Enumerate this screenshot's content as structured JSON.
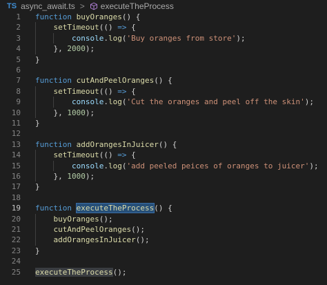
{
  "breadcrumb": {
    "language_badge": "TS",
    "file_name": "async_await.ts",
    "separator": ">",
    "symbol_icon": "cube-icon",
    "symbol_name": "executeTheProcess"
  },
  "colors": {
    "background": "#1e1e1e",
    "keyword": "#569cd6",
    "function": "#dcdcaa",
    "string": "#ce9178",
    "number": "#b5cea8",
    "property": "#9cdcfe",
    "selection": "#264f78"
  },
  "editor": {
    "active_line": 19,
    "lines": [
      {
        "n": "1",
        "tokens": [
          {
            "t": "function ",
            "c": "kw"
          },
          {
            "t": "buyOranges",
            "c": "fn"
          },
          {
            "t": "() {"
          }
        ]
      },
      {
        "n": "2",
        "tokens": [
          {
            "t": "    "
          },
          {
            "t": "setTimeout",
            "c": "fn"
          },
          {
            "t": "(() "
          },
          {
            "t": "=>",
            "c": "kw"
          },
          {
            "t": " {"
          }
        ]
      },
      {
        "n": "3",
        "tokens": [
          {
            "t": "        "
          },
          {
            "t": "console",
            "c": "var"
          },
          {
            "t": "."
          },
          {
            "t": "log",
            "c": "fn"
          },
          {
            "t": "("
          },
          {
            "t": "'Buy oranges from store'",
            "c": "str"
          },
          {
            "t": ");"
          }
        ]
      },
      {
        "n": "4",
        "tokens": [
          {
            "t": "    }, "
          },
          {
            "t": "2000",
            "c": "num"
          },
          {
            "t": ");"
          }
        ]
      },
      {
        "n": "5",
        "tokens": [
          {
            "t": "}"
          }
        ]
      },
      {
        "n": "6",
        "tokens": []
      },
      {
        "n": "7",
        "tokens": [
          {
            "t": "function ",
            "c": "kw"
          },
          {
            "t": "cutAndPeelOranges",
            "c": "fn"
          },
          {
            "t": "() {"
          }
        ]
      },
      {
        "n": "8",
        "tokens": [
          {
            "t": "    "
          },
          {
            "t": "setTimeout",
            "c": "fn"
          },
          {
            "t": "(() "
          },
          {
            "t": "=>",
            "c": "kw"
          },
          {
            "t": " {"
          }
        ]
      },
      {
        "n": "9",
        "tokens": [
          {
            "t": "        "
          },
          {
            "t": "console",
            "c": "var"
          },
          {
            "t": "."
          },
          {
            "t": "log",
            "c": "fn"
          },
          {
            "t": "("
          },
          {
            "t": "'Cut the oranges and peel off the skin'",
            "c": "str"
          },
          {
            "t": ");"
          }
        ]
      },
      {
        "n": "10",
        "tokens": [
          {
            "t": "    }, "
          },
          {
            "t": "1000",
            "c": "num"
          },
          {
            "t": ");"
          }
        ]
      },
      {
        "n": "11",
        "tokens": [
          {
            "t": "}"
          }
        ]
      },
      {
        "n": "12",
        "tokens": []
      },
      {
        "n": "13",
        "tokens": [
          {
            "t": "function ",
            "c": "kw"
          },
          {
            "t": "addOrangesInJuicer",
            "c": "fn"
          },
          {
            "t": "() {"
          }
        ]
      },
      {
        "n": "14",
        "tokens": [
          {
            "t": "    "
          },
          {
            "t": "setTimeout",
            "c": "fn"
          },
          {
            "t": "(() "
          },
          {
            "t": "=>",
            "c": "kw"
          },
          {
            "t": " {"
          }
        ]
      },
      {
        "n": "15",
        "tokens": [
          {
            "t": "        "
          },
          {
            "t": "console",
            "c": "var"
          },
          {
            "t": "."
          },
          {
            "t": "log",
            "c": "fn"
          },
          {
            "t": "("
          },
          {
            "t": "'add peeled peices of oranges to juicer'",
            "c": "str"
          },
          {
            "t": ");"
          }
        ]
      },
      {
        "n": "16",
        "tokens": [
          {
            "t": "    }, "
          },
          {
            "t": "1000",
            "c": "num"
          },
          {
            "t": ");"
          }
        ]
      },
      {
        "n": "17",
        "tokens": [
          {
            "t": "}"
          }
        ]
      },
      {
        "n": "18",
        "tokens": []
      },
      {
        "n": "19",
        "tokens": [
          {
            "t": "function ",
            "c": "kw"
          },
          {
            "t": "executeTheProcess",
            "c": "fn",
            "h": "sel"
          },
          {
            "t": "() {"
          }
        ]
      },
      {
        "n": "20",
        "tokens": [
          {
            "t": "    "
          },
          {
            "t": "buyOranges",
            "c": "fn"
          },
          {
            "t": "();"
          }
        ]
      },
      {
        "n": "21",
        "tokens": [
          {
            "t": "    "
          },
          {
            "t": "cutAndPeelOranges",
            "c": "fn"
          },
          {
            "t": "();"
          }
        ]
      },
      {
        "n": "22",
        "tokens": [
          {
            "t": "    "
          },
          {
            "t": "addOrangesInJuicer",
            "c": "fn"
          },
          {
            "t": "();"
          }
        ]
      },
      {
        "n": "23",
        "tokens": [
          {
            "t": "}"
          }
        ]
      },
      {
        "n": "24",
        "tokens": []
      },
      {
        "n": "25",
        "tokens": [
          {
            "t": "executeTheProcess",
            "c": "fn",
            "h": "occ"
          },
          {
            "t": "();"
          }
        ]
      }
    ]
  }
}
